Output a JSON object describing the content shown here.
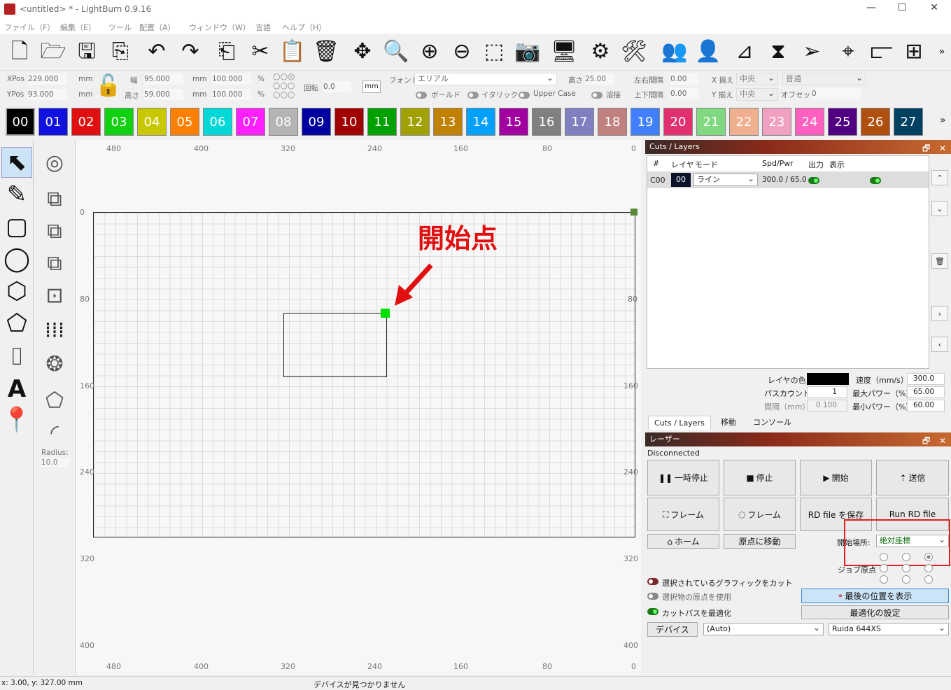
{
  "window": {
    "title": "<untitled> * - LightBurn 0.9.16",
    "minimize": "—",
    "maximize": "☐",
    "close": "✕"
  },
  "menu": [
    "ファイル（F）",
    "編集（E）",
    "ツール",
    "配置（A）",
    "ウィンドウ（W）",
    "言語",
    "ヘルプ（H）"
  ],
  "toolbar": {
    "icons": [
      "new-file-icon",
      "open-folder-icon",
      "save-icon",
      "import-icon",
      "undo-icon",
      "redo-icon",
      "copy-icon",
      "cut-icon",
      "paste-icon",
      "delete-icon",
      "move-icon",
      "zoom-page-icon",
      "zoom-in-icon",
      "zoom-out-icon",
      "frame-select-icon",
      "camera-icon",
      "monitor-icon",
      "settings-icon",
      "machine-settings-icon",
      "group-icon",
      "user-icon",
      "align-icon",
      "mirror-icon",
      "send-icon",
      "target-icon",
      "align-left-icon",
      "arrange-icon"
    ],
    "more": "»"
  },
  "props": {
    "xpos_label": "XPos",
    "xpos": "229.000",
    "ypos_label": "YPos",
    "ypos": "93.000",
    "unit": "mm",
    "width_label": "幅",
    "width": "95.000",
    "height_label": "高さ",
    "height": "59.000",
    "scale_w": "100.000",
    "scale_h": "100.000",
    "pct": "%",
    "rotate_label": "回転",
    "rotate": "0.0",
    "mm_btn": "mm",
    "font_label": "フォント",
    "font": "エリアル",
    "size_label": "高さ",
    "size": "25.00",
    "hspace_label": "左右間隔",
    "hspace": "0.00",
    "xalign_label": "X 揃え",
    "xalign": "中央",
    "style": "普通",
    "vspace_label": "上下間隔",
    "vspace": "0.00",
    "yalign_label": "Y 揃え",
    "yalign": "中央",
    "offset_label": "オフセット",
    "offset": "0",
    "bold": "ボールド",
    "italic": "イタリック",
    "upper": "Upper Case",
    "weld": "溶接"
  },
  "palette": [
    {
      "n": "00",
      "c": "#000000"
    },
    {
      "n": "01",
      "c": "#1010e0"
    },
    {
      "n": "02",
      "c": "#e01010"
    },
    {
      "n": "03",
      "c": "#10d010"
    },
    {
      "n": "04",
      "c": "#c8c800"
    },
    {
      "n": "05",
      "c": "#ff8000"
    },
    {
      "n": "06",
      "c": "#00d8d8"
    },
    {
      "n": "07",
      "c": "#ff20ff"
    },
    {
      "n": "08",
      "c": "#b4b4b4"
    },
    {
      "n": "09",
      "c": "#0000a0"
    },
    {
      "n": "10",
      "c": "#a00000"
    },
    {
      "n": "11",
      "c": "#00a000"
    },
    {
      "n": "12",
      "c": "#a0a000"
    },
    {
      "n": "13",
      "c": "#c08000"
    },
    {
      "n": "14",
      "c": "#00a0ff"
    },
    {
      "n": "15",
      "c": "#a000a0"
    },
    {
      "n": "16",
      "c": "#808080"
    },
    {
      "n": "17",
      "c": "#8080c0"
    },
    {
      "n": "18",
      "c": "#c08080"
    },
    {
      "n": "19",
      "c": "#4080ff"
    },
    {
      "n": "20",
      "c": "#e03070"
    },
    {
      "n": "21",
      "c": "#80d880"
    },
    {
      "n": "22",
      "c": "#f0b090"
    },
    {
      "n": "23",
      "c": "#f0a0c0"
    },
    {
      "n": "24",
      "c": "#ff60c0"
    },
    {
      "n": "25",
      "c": "#500080"
    },
    {
      "n": "26",
      "c": "#b05010"
    },
    {
      "n": "27",
      "c": "#004060"
    }
  ],
  "palette_more": "»",
  "lefttools": [
    "select-icon",
    "pencil-icon",
    "rectangle-icon",
    "ellipse-icon",
    "polygon-icon",
    "pentagon-icon",
    "frame-icon",
    "text-icon",
    "position-pin-icon"
  ],
  "lefttools2": [
    "offset-icon",
    "boolean-union-icon",
    "boolean-diff-icon",
    "boolean-intersect-icon",
    "weld-icon",
    "grid-array-icon",
    "circular-array-icon",
    "node-edit-icon",
    "fillet-icon"
  ],
  "radius_label": "Radius:",
  "radius": "10.0",
  "ruler": {
    "top": [
      "480",
      "400",
      "320",
      "240",
      "160",
      "80",
      "0"
    ],
    "left": [
      "0",
      "80",
      "160",
      "240",
      "320",
      "400"
    ],
    "right": [
      "80",
      "160",
      "240",
      "320",
      "400"
    ],
    "bottom": [
      "480",
      "400",
      "320",
      "240",
      "160",
      "80",
      "0"
    ]
  },
  "annotation": "開始点",
  "cuts": {
    "title": "Cuts / Layers",
    "headers": [
      "#",
      "レイヤ",
      "モード",
      "Spd/Pwr",
      "出力",
      "表示"
    ],
    "row": {
      "id": "C00",
      "layer": "00",
      "mode": "ライン",
      "spdpwr": "300.0 / 65.0"
    },
    "color_label": "レイヤの色",
    "pass_label": "パスカウント",
    "pass": "1",
    "interval_label": "間隔（mm）",
    "interval": "0.100",
    "speed_label": "速度（mm/s）",
    "speed": "300.0",
    "maxp_label": "最大パワー（%）",
    "maxp": "65.00",
    "minp_label": "最小パワー（%）",
    "minp": "60.00"
  },
  "tabs": [
    "Cuts / Layers",
    "移動",
    "コンソール"
  ],
  "laser": {
    "title": "レーザー",
    "status": "Disconnected",
    "pause": "一時停止",
    "stop": "停止",
    "start": "開始",
    "send": "送信",
    "frame1": "フレーム",
    "frame2": "フレーム",
    "save_rd": "RD file を保存",
    "run_rd": "Run RD file",
    "home": "ホーム",
    "goto_origin": "原点に移動",
    "start_from_label": "開始場所:",
    "start_from": "絶対座標",
    "job_origin_label": "ジョブ原点",
    "cut_sel": "選択されているグラフィックをカット",
    "use_origin": "選択物の原点を使用",
    "optimize": "カットパスを最適化",
    "show_last": "最後の位置を表示",
    "opt_settings": "最適化の設定",
    "device_btn": "デバイス",
    "device": "(Auto)",
    "model": "Ruida 644XS"
  },
  "status": {
    "coords": "x: 3.00, y: 327.00 mm",
    "msg": "デバイスが見つかりません"
  }
}
